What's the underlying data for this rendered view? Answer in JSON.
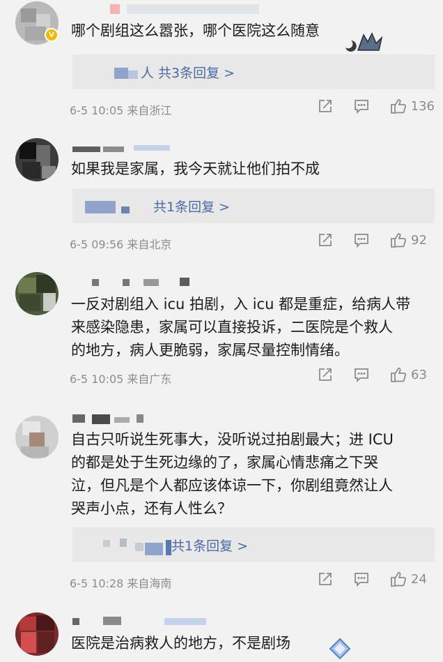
{
  "comments": [
    {
      "text": "哪个剧组这么嚣张，哪个医院这么随意",
      "reply_text": "人 共3条回复 >",
      "meta": "6-5 10:05 来自浙江",
      "likes": "136"
    },
    {
      "text": "如果我是家属，我今天就让他们拍不成",
      "reply_text": "共1条回复 >",
      "meta": "6-5 09:56 来自北京",
      "likes": "92"
    },
    {
      "text_lines": [
        "一反对剧组入 icu 拍剧，入 icu 都是重症，给病人带",
        "来感染隐患，家属可以直接投诉，二医院是个救人",
        "的地方，病人更脆弱，家属尽量控制情绪。"
      ],
      "meta": "6-5 10:05 来自广东",
      "likes": "63"
    },
    {
      "text_lines": [
        "自古只听说生死事大，没听说过拍剧最大；进 ICU",
        "的都是处于生死边缘的了，家属心情悲痛之下哭",
        "泣，但凡是个人都应该体谅一下，你剧组竟然让人",
        "哭声小点，还有人性么？"
      ],
      "reply_text": "共1条回复 >",
      "meta": "6-5 10:28 来自海南",
      "likes": "24"
    },
    {
      "text": "医院是治病救人的地方，不是剧场"
    }
  ],
  "colors": {
    "link": "#4b6aa8",
    "meta": "#8c8c8c",
    "background": "#f2f2f2",
    "reply_bg": "#e8e8e8"
  },
  "icons": [
    "share-icon",
    "comment-icon",
    "like-icon",
    "verified-badge-icon"
  ]
}
